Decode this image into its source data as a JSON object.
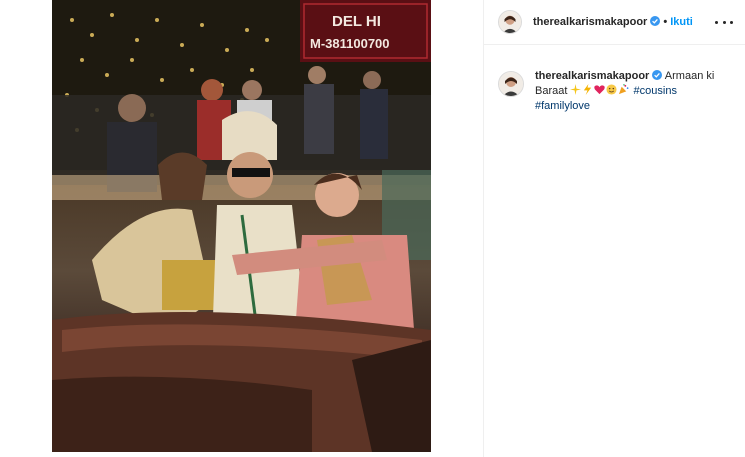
{
  "post": {
    "username": "therealkarismakapoor",
    "separator": "•",
    "follow_label": "Ikuti",
    "caption": {
      "username": "therealkarismakapoor",
      "text": "Armaan ki Baraat",
      "emojis": [
        "sparkles-icon",
        "lightning-icon",
        "red-heart-icon",
        "smiling-face-icon",
        "party-popper-icon"
      ],
      "hashtags": [
        "#cousins",
        "#familylove"
      ]
    }
  },
  "media": {
    "sign_line1": "DEL HI",
    "sign_line2": "M-381100700"
  },
  "colors": {
    "link": "#0095f6",
    "hashtag": "#00376b",
    "verified": "#3897f0"
  }
}
